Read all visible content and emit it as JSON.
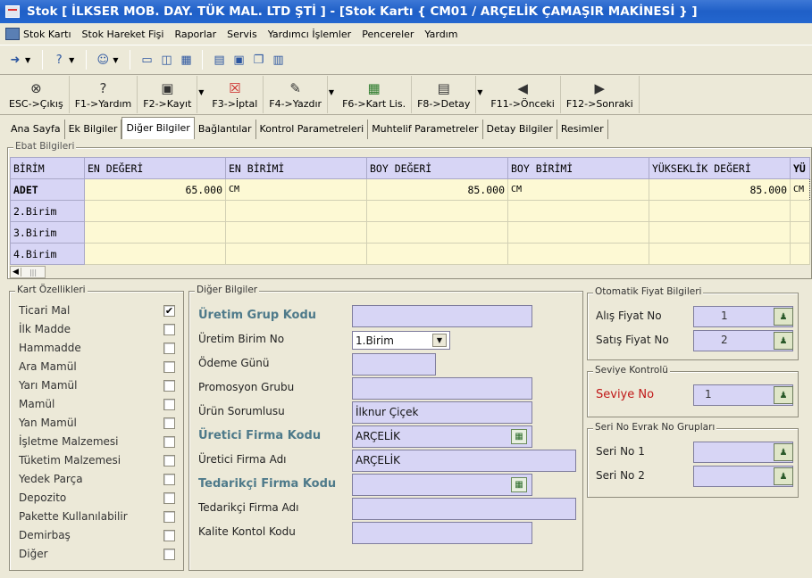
{
  "window": {
    "title": "Stok [ İLKSER MOB. DAY. TÜK MAL. LTD ŞTİ ] - [Stok Kartı { CM01 / ARÇELİK ÇAMAŞIR MAKİNESİ } ]"
  },
  "menu": {
    "items": [
      "Stok Kartı",
      "Stok Hareket Fişi",
      "Raporlar",
      "Servis",
      "Yardımcı İşlemler",
      "Pencereler",
      "Yardım"
    ]
  },
  "toolbar": {
    "buttons": [
      "ESC->Çıkış",
      "F1->Yardım",
      "F2->Kayıt",
      "F3->İptal",
      "F4->Yazdır",
      "F6->Kart Lis.",
      "F8->Detay",
      "F11->Önceki",
      "F12->Sonraki"
    ]
  },
  "tabs": [
    "Ana Sayfa",
    "Ek Bilgiler",
    "Diğer Bilgiler",
    "Bağlantılar",
    "Kontrol Parametreleri",
    "Muhtelif Parametreler",
    "Detay Bilgiler",
    "Resimler"
  ],
  "ebat": {
    "title": "Ebat Bilgileri",
    "columns": [
      "BİRİM",
      "EN DEĞERİ",
      "EN BİRİMİ",
      "BOY DEĞERİ",
      "BOY BİRİMİ",
      "YÜKSEKLİK DEĞERİ",
      "YÜ"
    ],
    "rows": [
      {
        "birim": "ADET",
        "en": "65.000",
        "en_birim": "CM",
        "boy": "85.000",
        "boy_birim": "CM",
        "yuk": "85.000",
        "yuk_birim": "CM"
      },
      {
        "birim": "2.Birim",
        "en": "",
        "en_birim": "",
        "boy": "",
        "boy_birim": "",
        "yuk": "",
        "yuk_birim": ""
      },
      {
        "birim": "3.Birim",
        "en": "",
        "en_birim": "",
        "boy": "",
        "boy_birim": "",
        "yuk": "",
        "yuk_birim": ""
      },
      {
        "birim": "4.Birim",
        "en": "",
        "en_birim": "",
        "boy": "",
        "boy_birim": "",
        "yuk": "",
        "yuk_birim": ""
      }
    ]
  },
  "kart": {
    "title": "Kart Özellikleri",
    "items": [
      {
        "label": "Ticari Mal",
        "checked": "✔"
      },
      {
        "label": "İlk Madde",
        "checked": ""
      },
      {
        "label": "Hammadde",
        "checked": ""
      },
      {
        "label": "Ara Mamül",
        "checked": ""
      },
      {
        "label": "Yarı Mamül",
        "checked": ""
      },
      {
        "label": "Mamül",
        "checked": ""
      },
      {
        "label": "Yan Mamül",
        "checked": ""
      },
      {
        "label": "İşletme Malzemesi",
        "checked": ""
      },
      {
        "label": "Tüketim Malzemesi",
        "checked": ""
      },
      {
        "label": "Yedek Parça",
        "checked": ""
      },
      {
        "label": "Depozito",
        "checked": ""
      },
      {
        "label": "Pakette Kullanılabilir",
        "checked": ""
      },
      {
        "label": "Demirbaş",
        "checked": ""
      },
      {
        "label": "Diğer",
        "checked": ""
      }
    ]
  },
  "diger": {
    "title": "Diğer Bilgiler",
    "uretim_grup_label": "Üretim Grup Kodu",
    "uretim_grup_value": "",
    "uretim_birim_label": "Üretim Birim No",
    "uretim_birim_value": "1.Birim",
    "odeme_label": "Ödeme Günü",
    "odeme_value": "",
    "promosyon_label": "Promosyon Grubu",
    "promosyon_value": "",
    "sorumlu_label": "Ürün Sorumlusu",
    "sorumlu_value": "İlknur Çiçek",
    "uretici_kod_label": "Üretici Firma Kodu",
    "uretici_kod_value": "ARÇELİK",
    "uretici_ad_label": "Üretici Firma Adı",
    "uretici_ad_value": "ARÇELİK",
    "tedarikci_kod_label": "Tedarikçi Firma Kodu",
    "tedarikci_kod_value": "",
    "tedarikci_ad_label": "Tedarikçi Firma Adı",
    "tedarikci_ad_value": "",
    "kalite_label": "Kalite Kontol Kodu",
    "kalite_value": ""
  },
  "fiyat": {
    "title": "Otomatik Fiyat Bilgileri",
    "alis_label": "Alış Fiyat No",
    "alis_value": "1",
    "satis_label": "Satış Fiyat No",
    "satis_value": "2"
  },
  "seviye": {
    "title": "Seviye Kontrolü",
    "label": "Seviye No",
    "value": "1"
  },
  "seri": {
    "title": "Seri No Evrak No Grupları",
    "seri1_label": "Seri No 1",
    "seri1_value": "",
    "seri2_label": "Seri No 2",
    "seri2_value": ""
  }
}
